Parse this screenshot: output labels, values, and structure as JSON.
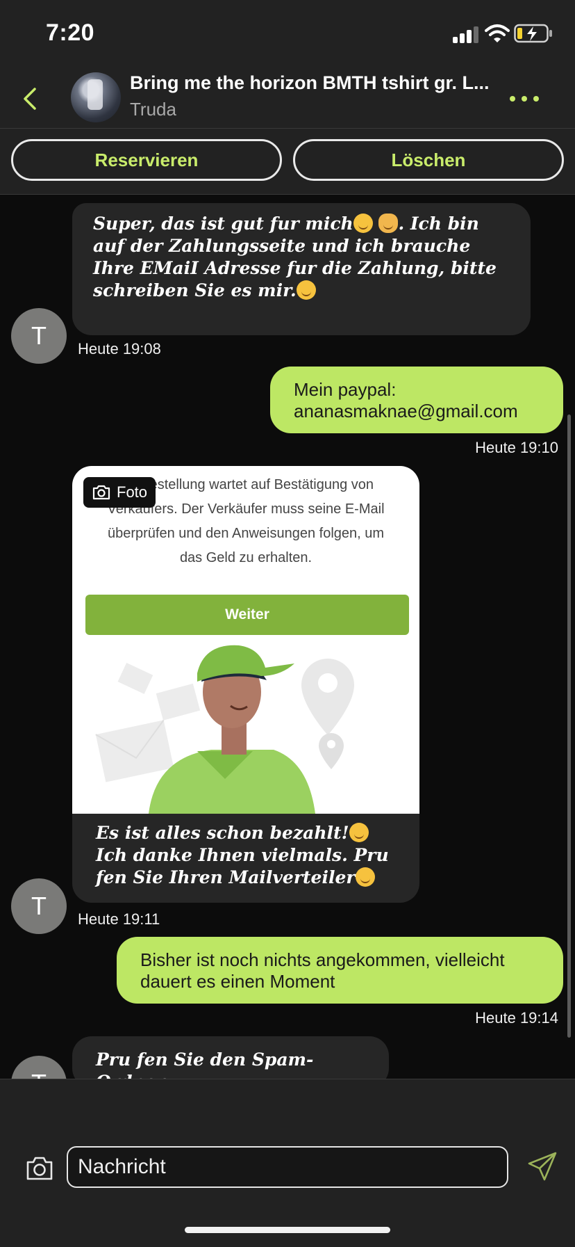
{
  "status_bar": {
    "time": "7:20"
  },
  "header": {
    "title": "Bring me the horizon BMTH tshirt gr. L...",
    "subtitle": "Truda"
  },
  "actions": {
    "reserve": "Reservieren",
    "delete": "Löschen"
  },
  "messages": [
    {
      "from": "Truda",
      "avatar_letter": "T",
      "text_a": "Super, das ist gut  fur mich",
      "text_b": ". Ich bin auf der Zahlungsseite und ich brauche Ihre EMaiI Adresse  fur die Zahlung, bitte schreiben Sie es mir.",
      "time": "Heute 19:08"
    },
    {
      "from": "me",
      "text": "Mein paypal: ananasmaknae@gmail.com",
      "time": "Heute 19:10"
    },
    {
      "from": "Truda",
      "avatar_letter": "T",
      "photo_badge": "Foto",
      "photo_text": "die Bestellung wartet auf Bestätigung von Verkäufers. Der Verkäufer muss seine E-Mail überprüfen und den Anweisungen folgen, um das Geld zu erhalten.",
      "photo_button": "Weiter",
      "text_a": "Es ist alles schon bezahlt!",
      "text_b": " Ich danke Ihnen vielmals. Pru fen Sie Ihren Mailverteiler",
      "time": "Heute 19:11"
    },
    {
      "from": "me",
      "text": "Bisher ist noch nichts angekommen, vielleicht dauert es einen Moment",
      "time": "Heute 19:14"
    },
    {
      "from": "Truda",
      "avatar_letter": "T",
      "text": "Pru fen Sie den Spam-Ordner"
    }
  ],
  "composer": {
    "placeholder": "Nachricht"
  },
  "colors": {
    "accent": "#c9ec6b",
    "outgoing_bubble": "#bde764",
    "incoming_bubble": "#262626",
    "background": "#0c0c0c",
    "bar": "#222222"
  },
  "icons": [
    "back-chevron-icon",
    "more-dots-icon",
    "camera-icon",
    "send-icon",
    "signal-icon",
    "wifi-icon",
    "battery-charging-icon"
  ]
}
